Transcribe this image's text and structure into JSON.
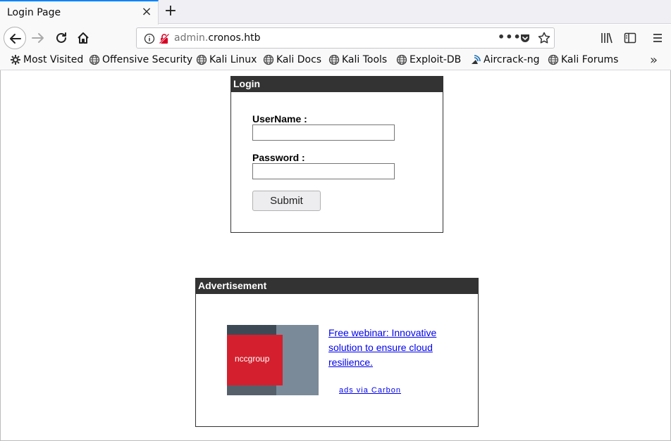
{
  "tab": {
    "title": "Login Page"
  },
  "urlbar": {
    "domain_prefix": "admin.",
    "domain_main": "cronos.htb"
  },
  "bookmarks": [
    {
      "label": "Most Visited",
      "icon": "gear-icon"
    },
    {
      "label": "Offensive Security",
      "icon": "globe-icon"
    },
    {
      "label": "Kali Linux",
      "icon": "globe-icon"
    },
    {
      "label": "Kali Docs",
      "icon": "globe-icon"
    },
    {
      "label": "Kali Tools",
      "icon": "globe-icon"
    },
    {
      "label": "Exploit-DB",
      "icon": "globe-icon"
    },
    {
      "label": "Aircrack-ng",
      "icon": "aircrack-icon"
    },
    {
      "label": "Kali Forums",
      "icon": "globe-icon"
    }
  ],
  "login": {
    "header": "Login",
    "username_label": "UserName :",
    "username_value": "",
    "password_label": "Password :",
    "password_value": "",
    "submit_label": "Submit"
  },
  "ad": {
    "header": "Advertisement",
    "brand": "nccgroup",
    "link_text": "Free webinar: Innovative solution to ensure cloud resilience.",
    "via_text": "ads via Carbon"
  },
  "colors": {
    "accent": "#0a84ff",
    "header_bg": "#333333",
    "link": "#0000ee",
    "ad_red": "#d4202e"
  }
}
